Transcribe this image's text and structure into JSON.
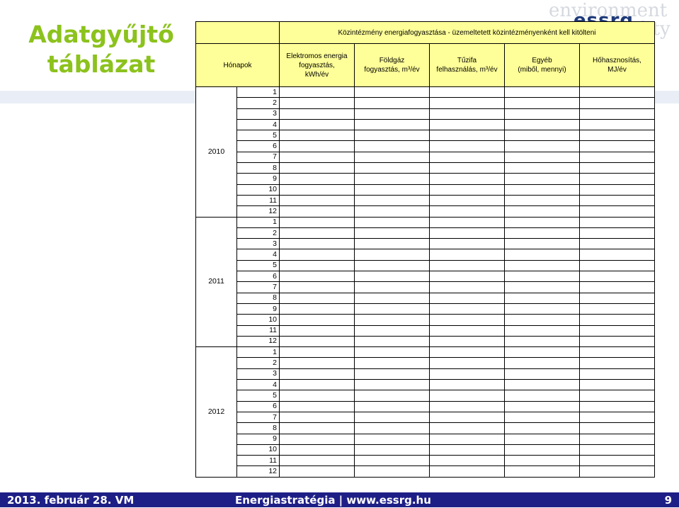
{
  "slide": {
    "title_line1": "Adatgyűjtő",
    "title_line2": "táblázat",
    "logo_ghost_line1": "environment",
    "logo_ghost_line2": "sustainability",
    "logo_brand": "essrg"
  },
  "table": {
    "main_header": "Közintézmény energiafogyasztása - üzemeltetett közintézményenként kell kitölteni",
    "columns": {
      "month": "Hónapok",
      "electric": [
        "Elektromos energia",
        "fogyasztás,",
        "kWh/év"
      ],
      "gas": [
        "Földgáz",
        "fogyasztás, m³/év"
      ],
      "wood": [
        "Tűzifa",
        "felhasználás, m³/év"
      ],
      "other": [
        "Egyéb",
        "(miből, mennyi)"
      ],
      "heat": [
        "Hőhasznosítás,",
        "MJ/év"
      ]
    },
    "years": [
      "2010",
      "2011",
      "2012"
    ],
    "months": [
      "1",
      "2",
      "3",
      "4",
      "5",
      "6",
      "7",
      "8",
      "9",
      "10",
      "11",
      "12"
    ]
  },
  "footer": {
    "date": "2013. február 28. VM",
    "center": "Energiastratégia | www.essrg.hu",
    "page": "9"
  },
  "colors": {
    "title_green": "#8cc21d",
    "header_yellow": "#ffff99",
    "footer_blue": "#1e1f86",
    "logo_blue": "#1e3a7a"
  }
}
